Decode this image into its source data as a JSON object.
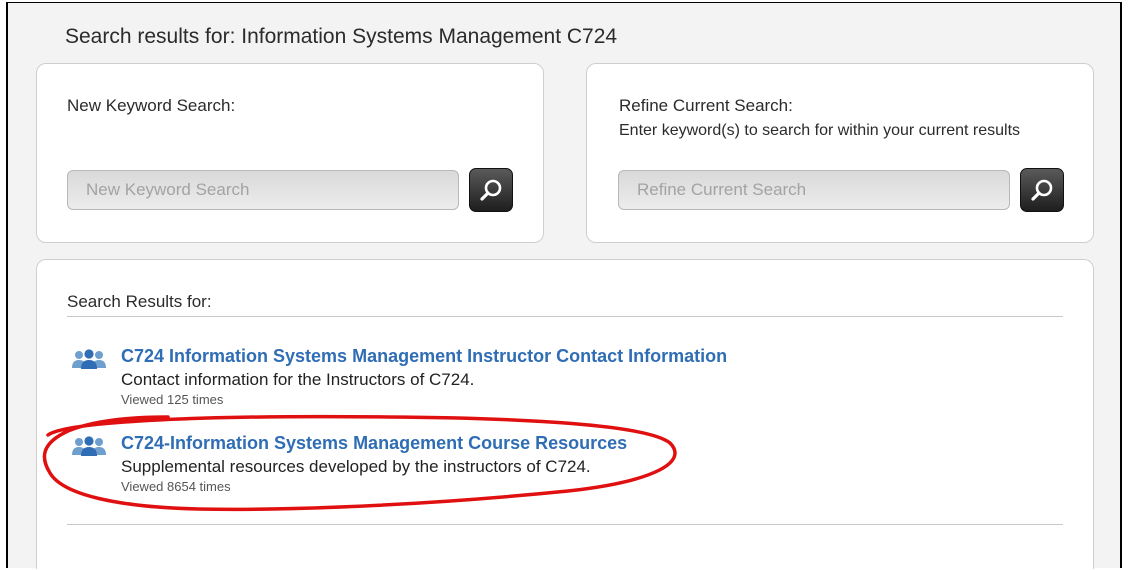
{
  "page_title": "Search results for: Information Systems Management C724",
  "new_search": {
    "heading": "New Keyword Search:",
    "placeholder": "New Keyword Search",
    "button_icon": "search-icon"
  },
  "refine_search": {
    "heading": "Refine Current Search:",
    "description": "Enter keyword(s) to search for within your current results",
    "placeholder": "Refine Current Search",
    "button_icon": "search-icon"
  },
  "results": {
    "heading": "Search Results for:",
    "items": [
      {
        "icon": "group-icon",
        "title": "C724 Information Systems Management Instructor Contact Information",
        "description": "Contact information for the Instructors of C724.",
        "views": "Viewed 125 times"
      },
      {
        "icon": "group-icon",
        "title": "C724-Information Systems Management Course Resources",
        "description": "Supplemental resources developed by the instructors of C724.",
        "views": "Viewed 8654 times"
      }
    ]
  },
  "colors": {
    "link": "#2f6db5",
    "annotation": "#e01010"
  }
}
